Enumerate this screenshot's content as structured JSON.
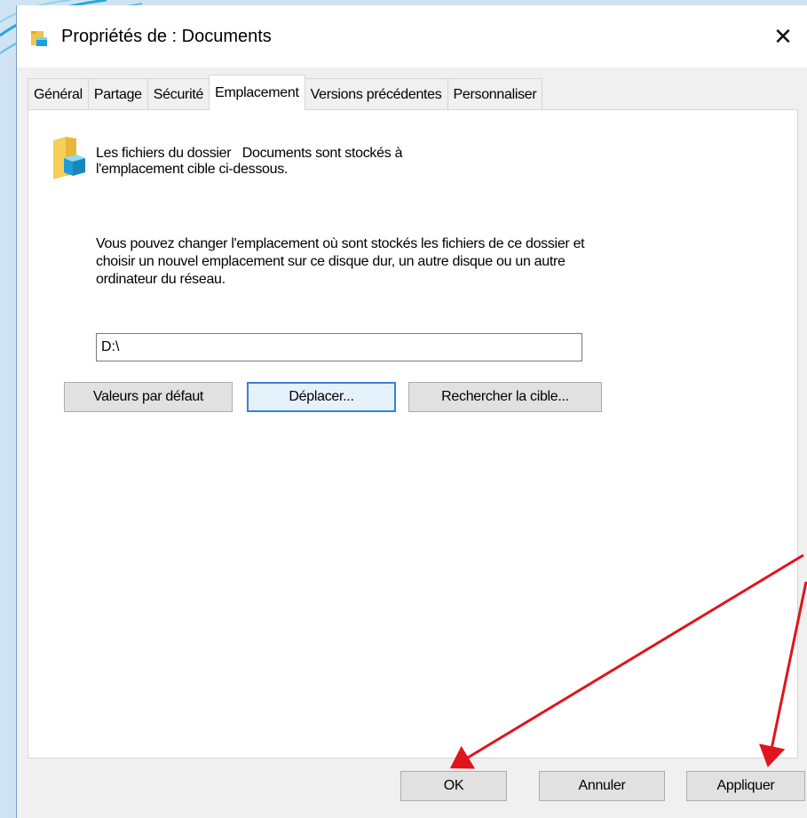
{
  "window": {
    "title_prefix": "Propriétés de : ",
    "title_folder": "Documents",
    "close_glyph": "✕"
  },
  "tabs": [
    {
      "label": "Général"
    },
    {
      "label": "Partage"
    },
    {
      "label": "Sécurité"
    },
    {
      "label": "Emplacement",
      "active": true
    },
    {
      "label": "Versions précédentes"
    },
    {
      "label": "Personnaliser"
    }
  ],
  "panel": {
    "info_line1": "Les fichiers du dossier   Documents sont stockés à",
    "info_line2": "l'emplacement cible ci-dessous.",
    "description": "Vous pouvez changer l'emplacement où sont stockés les fichiers de ce dossier et choisir un nouvel emplacement sur ce disque dur, un autre disque ou un autre ordinateur du réseau.",
    "path_value": "D:\\",
    "buttons": {
      "defaults": "Valeurs par défaut",
      "move": "Déplacer...",
      "find_target": "Rechercher la cible..."
    }
  },
  "footer": {
    "ok": "OK",
    "cancel": "Annuler",
    "apply": "Appliquer"
  },
  "colors": {
    "annotation_arrow": "#e0141c",
    "default_button_border": "#3a80d8"
  },
  "icons": {
    "title": "folder-icon",
    "panel": "folder-icon",
    "close": "close-icon"
  }
}
